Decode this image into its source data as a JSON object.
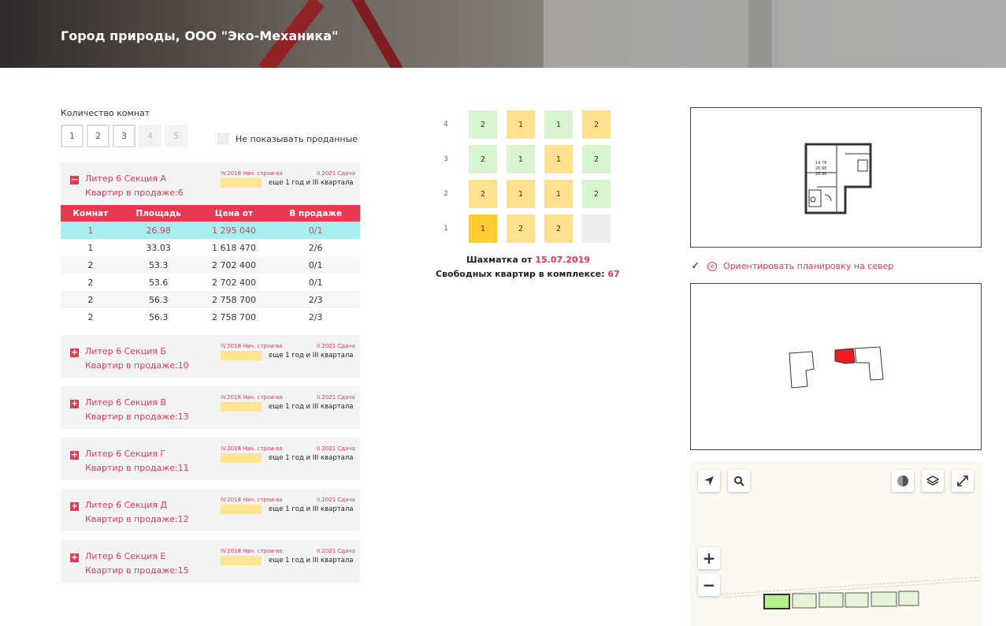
{
  "header": {
    "title": "Город природы, ООО \"Эко-Механика\""
  },
  "filters": {
    "rooms_label": "Количество комнат",
    "rooms": [
      {
        "label": "1",
        "disabled": false
      },
      {
        "label": "2",
        "disabled": false
      },
      {
        "label": "3",
        "disabled": false
      },
      {
        "label": "4",
        "disabled": true
      },
      {
        "label": "5",
        "disabled": true
      }
    ],
    "hide_sold_label": "Не показывать проданные"
  },
  "table_headers": [
    "Комнат",
    "Площадь",
    "Цена от",
    "В продаже"
  ],
  "sections": [
    {
      "toggle": "−",
      "title": "Литер 6 Секция А",
      "sale": "Квартир в продаже:6",
      "start": "IV.2018 Нач. строи-ва",
      "end": "II.2021 Сдача",
      "remaining": "еще 1 год и III квартала",
      "expanded": true,
      "rows": [
        {
          "rooms": "1",
          "area": "26.98",
          "price": "1 295 040",
          "sale": "0/1",
          "selected": true
        },
        {
          "rooms": "1",
          "area": "33.03",
          "price": "1 618 470",
          "sale": "2/6"
        },
        {
          "rooms": "2",
          "area": "53.3",
          "price": "2 702 400",
          "sale": "0/1"
        },
        {
          "rooms": "2",
          "area": "53.6",
          "price": "2 702 400",
          "sale": "0/1"
        },
        {
          "rooms": "2",
          "area": "56.3",
          "price": "2 758 700",
          "sale": "2/3"
        },
        {
          "rooms": "2",
          "area": "56.3",
          "price": "2 758 700",
          "sale": "2/3"
        }
      ]
    },
    {
      "toggle": "+",
      "title": "Литер 6 Секция Б",
      "sale": "Квартир в продаже:10",
      "start": "IV.2018 Нач. строи-ва",
      "end": "II.2021 Сдача",
      "remaining": "еще 1 год и III квартала",
      "expanded": false,
      "rows": []
    },
    {
      "toggle": "+",
      "title": "Литер 6 Секция В",
      "sale": "Квартир в продаже:13",
      "start": "IV.2018 Нач. строи-ва",
      "end": "II.2021 Сдача",
      "remaining": "еще 1 год и III квартала",
      "expanded": false,
      "rows": []
    },
    {
      "toggle": "+",
      "title": "Литер 6 Секция Г",
      "sale": "Квартир в продаже:11",
      "start": "IV.2018 Нач. строи-ва",
      "end": "II.2021 Сдача",
      "remaining": "еще 1 год и III квартала",
      "expanded": false,
      "rows": []
    },
    {
      "toggle": "+",
      "title": "Литер 6 Секция Д",
      "sale": "Квартир в продаже:12",
      "start": "IV.2018 Нач. строи-ва",
      "end": "II.2021 Сдача",
      "remaining": "еще 1 год и III квартала",
      "expanded": false,
      "rows": []
    },
    {
      "toggle": "+",
      "title": "Литер 6 Секция Е",
      "sale": "Квартир в продаже:15",
      "start": "IV.2018 Нач. строи-ва",
      "end": "II.2021 Сдача",
      "remaining": "еще 1 год и III квартала",
      "expanded": false,
      "rows": []
    }
  ],
  "chessboard": {
    "floors": [
      {
        "num": "4",
        "cells": [
          {
            "v": "2",
            "c": "green"
          },
          {
            "v": "1",
            "c": "yellow"
          },
          {
            "v": "1",
            "c": "green"
          },
          {
            "v": "2",
            "c": "yellow"
          }
        ]
      },
      {
        "num": "3",
        "cells": [
          {
            "v": "2",
            "c": "green"
          },
          {
            "v": "1",
            "c": "green"
          },
          {
            "v": "1",
            "c": "yellow"
          },
          {
            "v": "2",
            "c": "green"
          }
        ]
      },
      {
        "num": "2",
        "cells": [
          {
            "v": "2",
            "c": "yellow"
          },
          {
            "v": "1",
            "c": "yellow"
          },
          {
            "v": "1",
            "c": "yellow"
          },
          {
            "v": "2",
            "c": "green"
          }
        ]
      },
      {
        "num": "1",
        "cells": [
          {
            "v": "1",
            "c": "orange"
          },
          {
            "v": "2",
            "c": "yellow"
          },
          {
            "v": "2",
            "c": "yellow"
          },
          {
            "v": "",
            "c": "grey"
          }
        ]
      }
    ],
    "date_label": "Шахматка от",
    "date": "15.07.2019",
    "free_label": "Свободных квартир в комплексе:",
    "free_count": "67"
  },
  "plan": {
    "areas": [
      "14.78",
      "26.98",
      "26.98"
    ],
    "orient_label": "Ориентировать планировку на север",
    "orient_checked": true
  },
  "map": {
    "buttons": [
      "location-arrow-icon",
      "search-icon",
      "traffic-icon",
      "layers-icon",
      "fullscreen-icon"
    ],
    "zoom_in": "+",
    "zoom_out": "−"
  },
  "colors": {
    "accent": "#e53a52",
    "green": "#d9f5cf",
    "yellow": "#ffe08f",
    "orange": "#ffcc33",
    "selected_row": "#a6efee"
  }
}
